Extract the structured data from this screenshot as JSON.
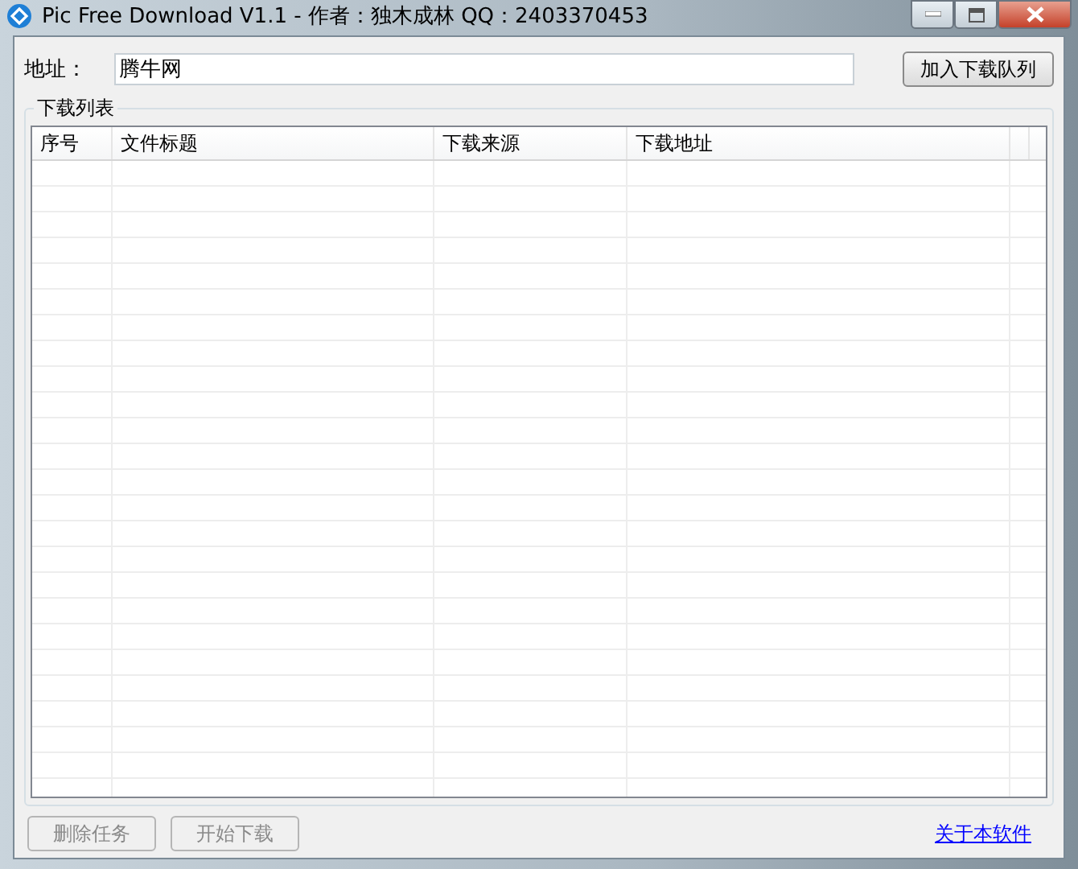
{
  "window": {
    "title": "Pic Free Download V1.1 - 作者：独木成林 QQ：2403370453"
  },
  "address": {
    "label": "地址：",
    "value": "腾牛网"
  },
  "add_button": {
    "label": "加入下载队列",
    "disabled": false
  },
  "group": {
    "title": "下载列表"
  },
  "table": {
    "columns": [
      "序号",
      "文件标题",
      "下载来源",
      "下载地址"
    ]
  },
  "buttons": [
    {
      "label": "删除任务",
      "disabled": true
    },
    {
      "label": "开始下载",
      "disabled": true
    }
  ],
  "about_link": "关于本软件"
}
